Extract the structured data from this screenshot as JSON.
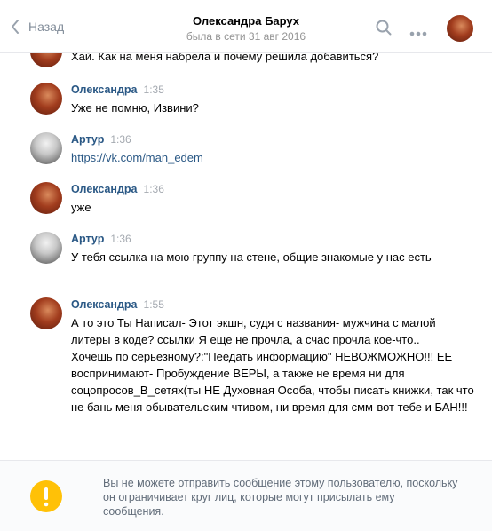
{
  "header": {
    "back_label": "Назад",
    "title": "Олександра Барух",
    "subtitle": "была в сети 31 авг 2016"
  },
  "partial_message": {
    "text": "Хай. Как на меня набрела и почему решила добавиться?"
  },
  "messages": [
    {
      "author": "Олександра",
      "time": "1:35",
      "text": "Уже не помню, Извини?"
    },
    {
      "author": "Артур",
      "time": "1:36",
      "link": "https://vk.com/man_edem"
    },
    {
      "author": "Олександра",
      "time": "1:36",
      "text": "уже"
    },
    {
      "author": "Артур",
      "time": "1:36",
      "text": "У тебя ссылка на мою группу на стене, общие знакомые у нас есть"
    },
    {
      "author": "Олександра",
      "time": "1:55",
      "text": "А то это Ты Написал- Этот экшн, судя с названия- мужчина с малой литеры в коде? ссылки Я еще не прочла, а счас прочла кое-что..\nХочешь по серьезному?:\"Пеедать информацию\" НЕВОЖМОЖНО!!! ЕЕ воспринимают- Пробуждение ВЕРЫ, а также не время ни для соцопросов_В_сетях(ты НЕ Духовная Особа, чтобы писать книжки, так что не бань меня обывательским чтивом, ни время для смм-вот тебе и БАН!!!"
    }
  ],
  "footer": {
    "notice": "Вы не можете отправить сообщение этому пользователю, поскольку он ограничивает круг лиц, которые могут присылать ему сообщения."
  },
  "colors": {
    "author": "#2a5885",
    "warning": "#ffc107",
    "muted": "#818c99"
  },
  "icons": [
    "back-chevron-icon",
    "search-icon",
    "more-icon",
    "warning-icon"
  ]
}
